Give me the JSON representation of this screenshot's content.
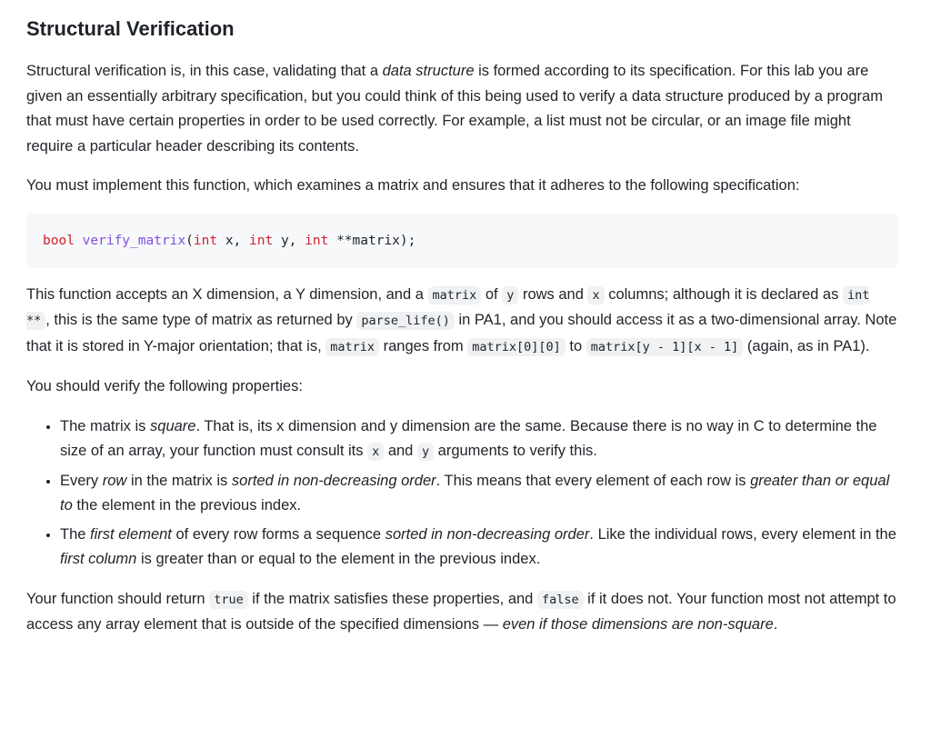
{
  "heading": "Structural Verification",
  "intro": {
    "t1": "Structural verification is, in this case, validating that a ",
    "em1": "data structure",
    "t2": " is formed according to its specification. For this lab you are given an essentially arbitrary specification, but you could think of this being used to verify a data structure produced by a program that must have certain properties in order to be used correctly. For example, a list must not be circular, or an image file might require a particular header describing its contents."
  },
  "implement": "You must implement this function, which examines a matrix and ensures that it adheres to the following specification:",
  "code": {
    "kw_bool": "bool",
    "fn_name": "verify_matrix",
    "open": "(",
    "kw_int1": "int",
    "p1": " x, ",
    "kw_int2": "int",
    "p2": " y, ",
    "kw_int3": "int",
    "p3": " **matrix);"
  },
  "desc": {
    "t1": "This function accepts an X dimension, a Y dimension, and a ",
    "c1": "matrix",
    "t2": " of ",
    "c2": "y",
    "t3": " rows and ",
    "c3": "x",
    "t4": " columns; although it is declared as ",
    "c4": "int **",
    "t5": ", this is the same type of matrix as returned by ",
    "c5": "parse_life()",
    "t6": " in PA1, and you should access it as a two-dimensional array. Note that it is stored in Y-major orientation; that is, ",
    "c6": "matrix",
    "t7": " ranges from ",
    "c7": "matrix[0][0]",
    "t8": " to ",
    "c8": "matrix[y - 1][x - 1]",
    "t9": " (again, as in PA1)."
  },
  "verify_intro": "You should verify the following properties:",
  "properties": [
    {
      "t1": "The matrix is ",
      "em1": "square",
      "t2": ". That is, its x dimension and y dimension are the same. Because there is no way in C to determine the size of an array, your function must consult its ",
      "c1": "x",
      "t3": " and ",
      "c2": "y",
      "t4": " arguments to verify this."
    },
    {
      "t1": "Every ",
      "em1": "row",
      "t2": " in the matrix is ",
      "em2": "sorted in non-decreasing order",
      "t3": ". This means that every element of each row is ",
      "em3": "greater than or equal to",
      "t4": " the element in the previous index."
    },
    {
      "t1": "The ",
      "em1": "first element",
      "t2": " of every row forms a sequence ",
      "em2": "sorted in non-decreasing order",
      "t3": ". Like the individual rows, every element in the ",
      "em3": "first column",
      "t4": " is greater than or equal to the element in the previous index."
    }
  ],
  "return": {
    "t1": "Your function should return ",
    "c1": "true",
    "t2": " if the matrix satisfies these properties, and ",
    "c2": "false",
    "t3": " if it does not. Your function most not attempt to access any array element that is outside of the specified dimensions — ",
    "em1": "even if those dimensions are non-square",
    "t4": "."
  }
}
